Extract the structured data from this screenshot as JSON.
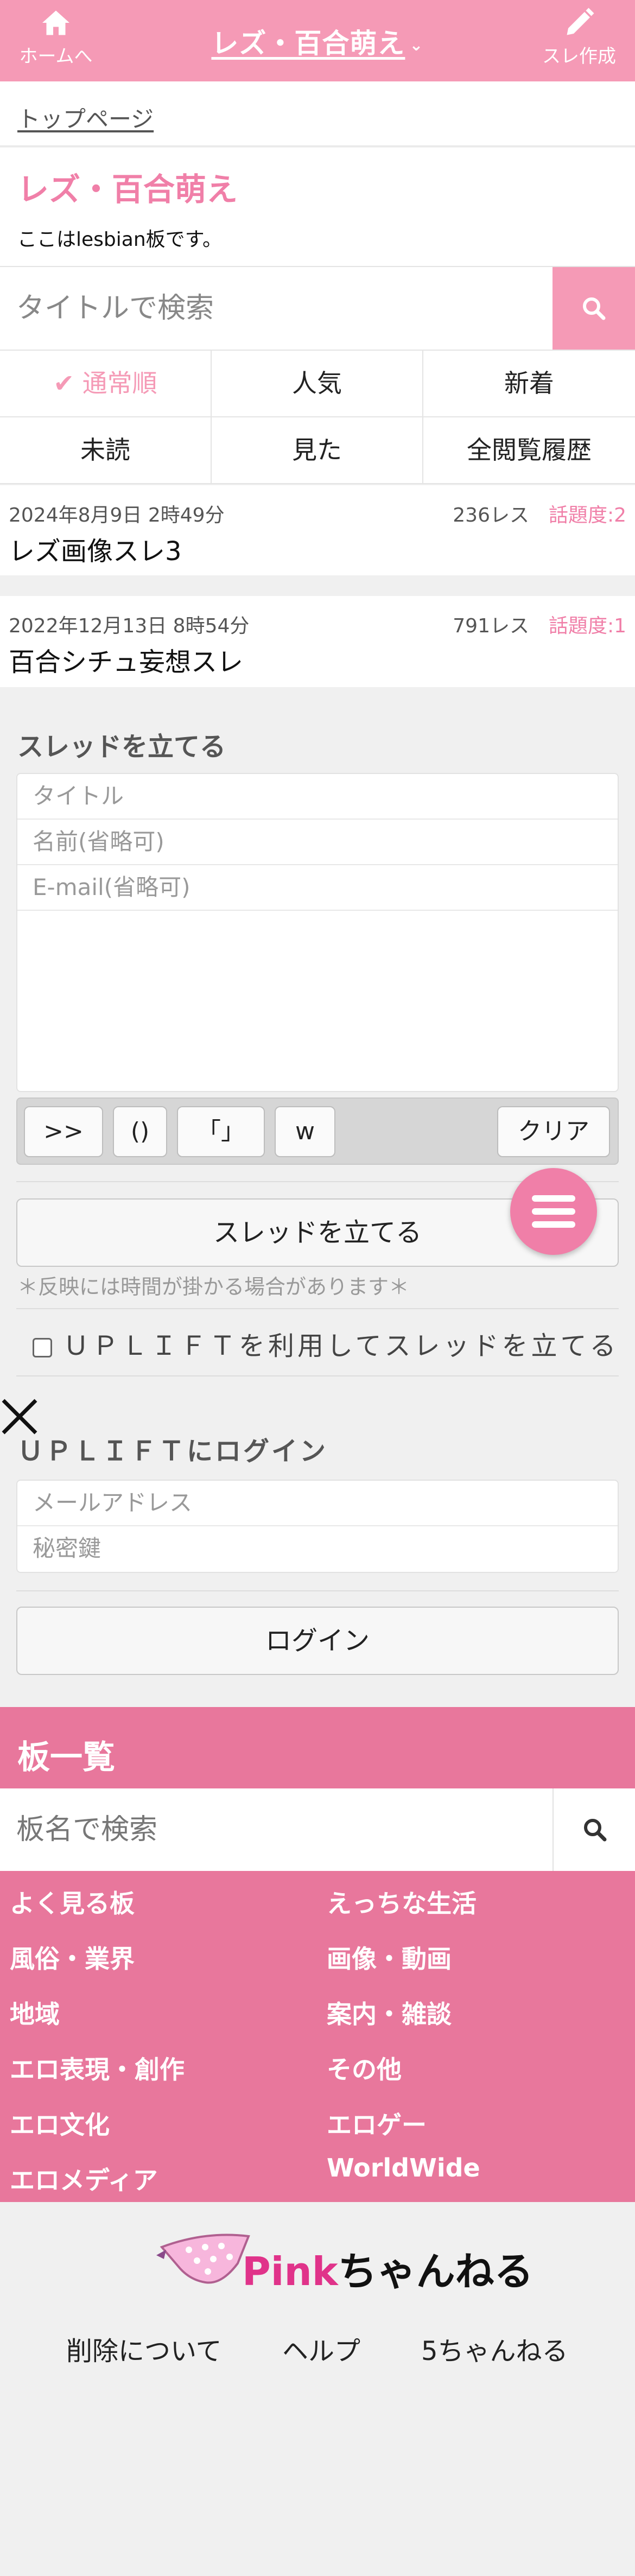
{
  "header": {
    "home_label": "ホームへ",
    "board_title": "レズ・百合萌え",
    "new_thread_label": "スレ作成",
    "brand_color": "#f59ab6"
  },
  "breadcrumb": {
    "top": "トップページ"
  },
  "board": {
    "title": "レズ・百合萌え",
    "description": "ここはlesbian板です。"
  },
  "search": {
    "placeholder": "タイトルで検索"
  },
  "sort": {
    "items": [
      "通常順",
      "人気",
      "新着",
      "未読",
      "見た",
      "全閲覧履歴"
    ],
    "active": "通常順"
  },
  "threads": [
    {
      "date": "2024年8月9日 2時49分",
      "res": "236レス",
      "heat": "話題度:2",
      "title": "レズ画像スレ3"
    },
    {
      "date": "2022年12月13日 8時54分",
      "res": "791レス",
      "heat": "話題度:1",
      "title": "百合シチュ妄想スレ"
    }
  ],
  "thread_form": {
    "heading": "スレッドを立てる",
    "title_placeholder": "タイトル",
    "name_placeholder": "名前(省略可)",
    "email_placeholder": "E-mail(省略可)",
    "tool_buttons": [
      ">>",
      "()",
      "「」",
      "w"
    ],
    "clear_label": "クリア",
    "submit_label": "スレッドを立てる",
    "note": "＊反映には時間が掛かる場合があります＊",
    "uplift_checkbox_label": "ＵＰＬＩＦＴを利用してスレッドを立てる"
  },
  "uplift_login": {
    "heading": "ＵＰＬＩＦＴにログイン",
    "email_placeholder": "メールアドレス",
    "secret_placeholder": "秘密鍵",
    "login_label": "ログイン"
  },
  "board_list": {
    "heading": "板一覧",
    "search_placeholder": "板名で検索",
    "categories": [
      "よく見る板",
      "えっちな生活",
      "風俗・業界",
      "画像・動画",
      "地域",
      "案内・雑談",
      "エロ表現・創作",
      "その他",
      "エロ文化",
      "エロゲー",
      "エロメディア",
      "WorldWide"
    ],
    "accent_color": "#e8779c"
  },
  "footer": {
    "logo_text": "Pinkちゃんねる",
    "links": [
      "削除について",
      "ヘルプ",
      "5ちゃんねる"
    ]
  }
}
